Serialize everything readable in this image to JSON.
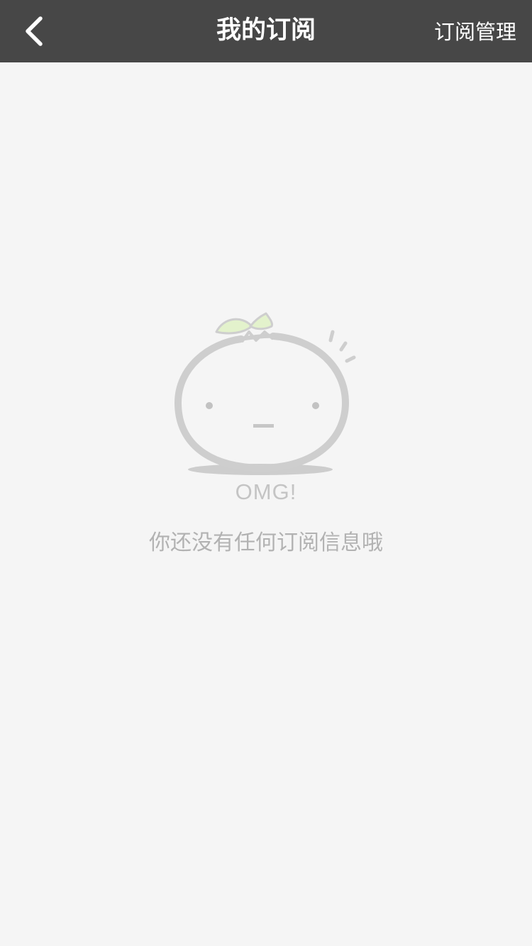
{
  "navbar": {
    "title": "我的订阅",
    "back_icon": "chevron-left-icon",
    "manage_label": "订阅管理",
    "background_color": "#474747",
    "text_color": "#ffffff"
  },
  "empty_state": {
    "illustration": "sad-tomato-mascot",
    "exclamation": "OMG!",
    "message": "你还没有任何订阅信息哦",
    "text_color": "#b2b2b2",
    "leaf_color": "#e3f2cc"
  }
}
